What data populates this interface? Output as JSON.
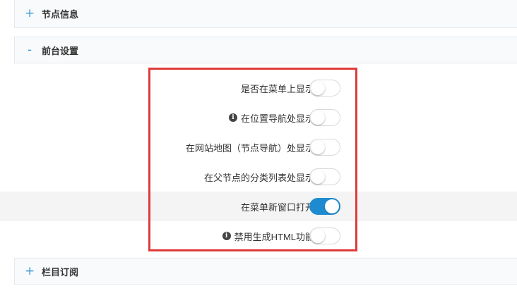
{
  "sections": {
    "node_info": {
      "icon": "plus-icon",
      "glyph": "+",
      "title": "节点信息"
    },
    "frontend_settings": {
      "icon": "minus-icon",
      "glyph": "-",
      "title": "前台设置"
    },
    "subscription": {
      "icon": "plus-icon",
      "glyph": "+",
      "title": "栏目订阅"
    }
  },
  "settings": [
    {
      "label": "是否在菜单上显示",
      "info": false,
      "on": false
    },
    {
      "label": "在位置导航处显示",
      "info": true,
      "on": false
    },
    {
      "label": "在网站地图（节点导航）处显示",
      "info": false,
      "on": false
    },
    {
      "label": "在父节点的分类列表处显示",
      "info": false,
      "on": false
    },
    {
      "label": "在菜单新窗口打开",
      "info": false,
      "on": true
    },
    {
      "label": "禁用生成HTML功能",
      "info": true,
      "on": false
    }
  ],
  "info_glyph": "i",
  "colors": {
    "accent": "#1e8bd0",
    "highlight": "#e03a3a"
  }
}
